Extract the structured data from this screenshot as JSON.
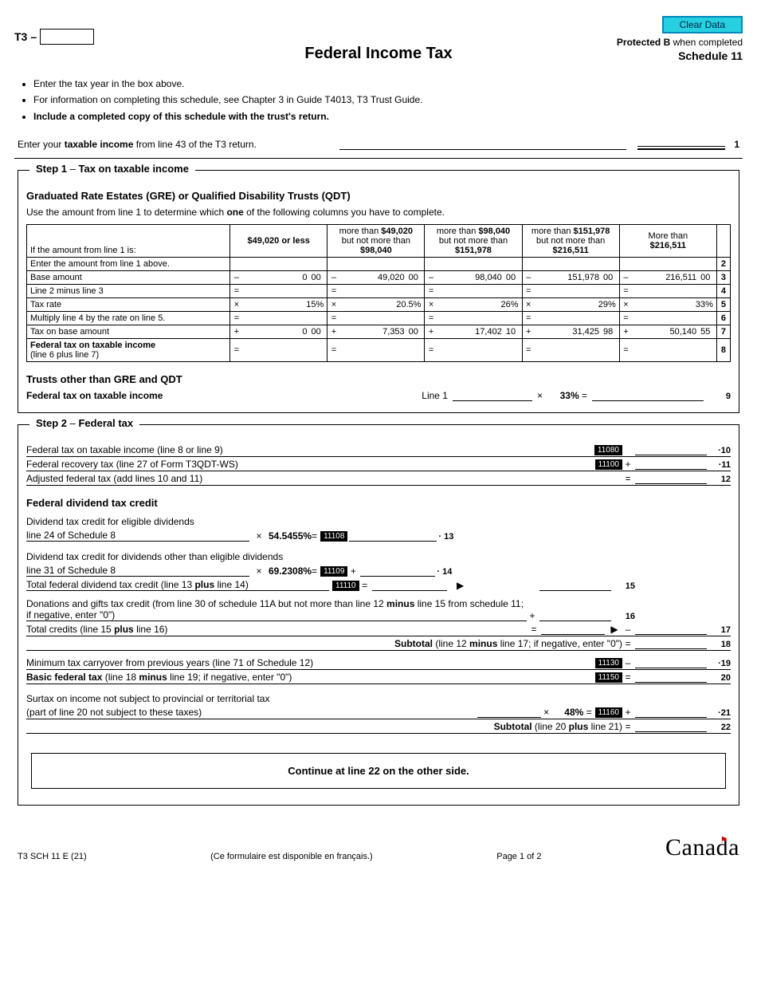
{
  "header": {
    "t3_prefix": "T3",
    "dash": "–",
    "clear_data": "Clear Data",
    "protected_b_bold": "Protected B",
    "protected_b_rest": " when completed",
    "schedule": "Schedule 11",
    "main_title": "Federal Income Tax"
  },
  "instructions": [
    "Enter the tax year in the box above.",
    "For information on completing this schedule, see Chapter 3 in Guide T4013, T3 Trust Guide."
  ],
  "instruction_bold": "Include a completed copy of this schedule with the trust's return.",
  "line1": {
    "prefix": "Enter your ",
    "bold": "taxable income",
    "suffix": " from line 43 of the T3 return.",
    "num": "1"
  },
  "step1": {
    "legend_step": "Step 1",
    "legend_dash": " – ",
    "legend_title": "Tax on taxable income",
    "gre_title": "Graduated Rate Estates (GRE) or Qualified Disability Trusts (QDT)",
    "gre_text_a": "Use the amount from line 1 to determine which ",
    "gre_text_bold": "one",
    "gre_text_b": " of the following columns you have to complete.",
    "col_head_label": "If the amount from line 1 is:",
    "col_heads": [
      "$49,020 or less",
      "",
      "",
      "",
      ""
    ],
    "col_head_rich": {
      "b_more": "more than ",
      "b1": "$49,020",
      "b_not": "but not more than",
      "b2": "$98,040",
      "c1": "$98,040",
      "c2": "$151,978",
      "d1": "$151,978",
      "d2": "$216,511",
      "e_more": "More than",
      "e1": "$216,511"
    },
    "rows": [
      {
        "label": "Enter the amount from line 1 above.",
        "op": "",
        "vals": [
          "",
          "",
          "",
          "",
          ""
        ],
        "cents": [
          "",
          "",
          "",
          "",
          ""
        ],
        "num": "2"
      },
      {
        "label": "Base amount",
        "op": "–",
        "vals": [
          "0",
          "49,020",
          "98,040",
          "151,978",
          "216,511"
        ],
        "cents": [
          "00",
          "00",
          "00",
          "00",
          "00"
        ],
        "num": "3"
      },
      {
        "label": "Line 2 minus line 3",
        "op": "=",
        "vals": [
          "",
          "",
          "",
          "",
          ""
        ],
        "cents": [
          "",
          "",
          "",
          "",
          ""
        ],
        "num": "4"
      },
      {
        "label": "Tax rate",
        "op": "×",
        "vals": [
          "15%",
          "20.5%",
          "26%",
          "29%",
          "33%"
        ],
        "cents": [
          "",
          "",
          "",
          "",
          ""
        ],
        "num": "5",
        "rate": true
      },
      {
        "label": "Multiply line 4 by the rate on line 5.",
        "op": "=",
        "vals": [
          "",
          "",
          "",
          "",
          ""
        ],
        "cents": [
          "",
          "",
          "",
          "",
          ""
        ],
        "num": "6"
      },
      {
        "label": "Tax on base amount",
        "op": "+",
        "vals": [
          "0",
          "7,353",
          "17,402",
          "31,425",
          "50,140"
        ],
        "cents": [
          "00",
          "00",
          "10",
          "98",
          "55"
        ],
        "num": "7"
      },
      {
        "label_a": "Federal tax on taxable income",
        "label_b": "(line 6 plus line 7)",
        "op": "=",
        "vals": [
          "",
          "",
          "",
          "",
          ""
        ],
        "cents": [
          "",
          "",
          "",
          "",
          ""
        ],
        "num": "8"
      }
    ],
    "other_trusts_head": "Trusts other than GRE and QDT",
    "line9": {
      "label": "Federal tax on taxable income",
      "line1_label": "Line 1",
      "times": "×",
      "rate": "33%",
      "eq": " =",
      "num": "9"
    }
  },
  "step2": {
    "legend_step": "Step 2",
    "legend_dash": " – ",
    "legend_title": "Federal tax",
    "rows": [
      {
        "txt": "Federal tax on taxable income (line 8 or line 9)",
        "box": "11080",
        "op": "",
        "dot": true,
        "num": "10"
      },
      {
        "txt": "Federal recovery tax (line 27 of Form T3QDT-WS)",
        "box": "11100",
        "op": "+",
        "dot": true,
        "num": "11"
      },
      {
        "txt": "Adjusted federal tax (add lines 10 and 11)",
        "box": "",
        "op": "=",
        "dot": false,
        "num": "12"
      }
    ],
    "div_head": "Federal dividend tax credit",
    "div13": {
      "a": "Dividend tax credit for eligible dividends",
      "b": "line 24 of Schedule 8",
      "times": "×",
      "pct": "54.5455%",
      "eq": " =",
      "box": "11108",
      "dot": "·",
      "num": "13"
    },
    "div14": {
      "a": "Dividend tax credit for dividends other than eligible dividends",
      "b": "line 31 of Schedule 8",
      "times": "×",
      "pct": "69.2308%",
      "eq": " =",
      "box": "11109",
      "op": "+",
      "dot": "·",
      "num": "14"
    },
    "div15": {
      "txt_a": "Total federal dividend tax credit (line 13 ",
      "bold": "plus",
      "txt_b": " line 14)",
      "box": "11110",
      "eq": "=",
      "arrow": "▶",
      "num": "15"
    },
    "line16": {
      "txt_a": "Donations and gifts tax credit (from line 30 of schedule 11A but not more than line 12 ",
      "bold1": "minus",
      "txt_b": " line 15 from schedule 11; if negative, enter \"0\")",
      "op": "+",
      "num": "16"
    },
    "line17": {
      "txt_a": "Total credits (line 15 ",
      "bold": "plus",
      "txt_b": " line 16)",
      "eq": "=",
      "arrow": "▶",
      "op": "–",
      "num": "17"
    },
    "line18": {
      "label_a": "Subtotal",
      "label_b": " (line 12 ",
      "bold": "minus",
      "label_c": " line 17; if negative, enter \"0\")",
      "op": "=",
      "num": "18"
    },
    "line19": {
      "txt": "Minimum tax carryover from previous years (line 71 of Schedule 12)",
      "box": "11130",
      "op": "–",
      "dot": true,
      "num": "19"
    },
    "line20": {
      "txt_a": "Basic federal tax",
      "txt_b": " (line 18 ",
      "bold": "minus",
      "txt_c": " line 19; if negative, enter \"0\")",
      "box": "11150",
      "op": "=",
      "num": "20"
    },
    "line21": {
      "txt_a": "Surtax on income not subject to provincial or territorial tax",
      "txt_b": "(part of line 20 not subject to these taxes)",
      "times": "×",
      "pct": "48%",
      "eq": " =",
      "box": "11160",
      "op": "+",
      "dot": true,
      "num": "21"
    },
    "line22": {
      "label_a": "Subtotal",
      "label_b": " (line 20 ",
      "bold": "plus",
      "label_c": " line 21)",
      "op": "=",
      "num": "22"
    },
    "continue": "Continue at line 22 on the other side."
  },
  "footer": {
    "form_id": "T3 SCH 11 E (21)",
    "french": "(Ce formulaire est disponible en français.)",
    "page": "Page 1 of 2",
    "canada": "Canada"
  }
}
